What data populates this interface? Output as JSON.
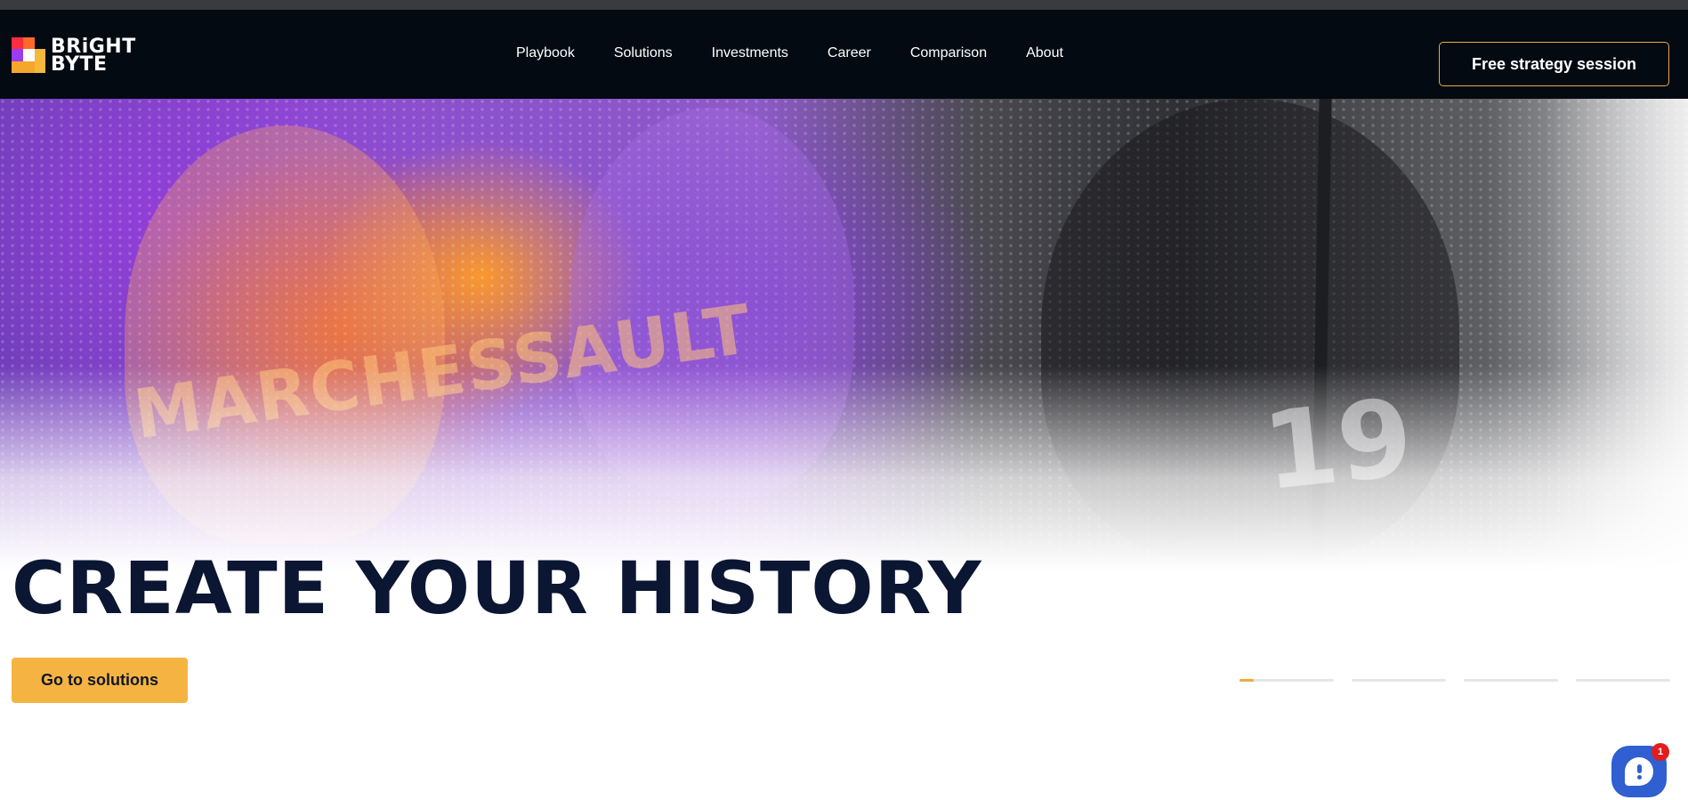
{
  "brand": {
    "logo_line1": "BRiGHT",
    "logo_line2": "BYTE"
  },
  "nav": {
    "items": [
      {
        "label": "Playbook"
      },
      {
        "label": "Solutions"
      },
      {
        "label": "Investments"
      },
      {
        "label": "Career"
      },
      {
        "label": "Comparison"
      },
      {
        "label": "About"
      }
    ]
  },
  "header": {
    "cta_label": "Free strategy session"
  },
  "hero": {
    "photo_jersey_text": "MARCHESSAULT",
    "photo_jersey_number": "19",
    "title": "CREATE YOUR HISTORY",
    "cta_label": "Go to solutions",
    "slider": {
      "count": 4,
      "active_index": 0,
      "active_progress": 0.15
    }
  },
  "chat": {
    "unread_count": "1"
  },
  "colors": {
    "header_bg": "#040a12",
    "accent": "#f5b441",
    "title": "#0b1633",
    "chat": "#2f5fd0",
    "badge": "#e11d1d"
  }
}
